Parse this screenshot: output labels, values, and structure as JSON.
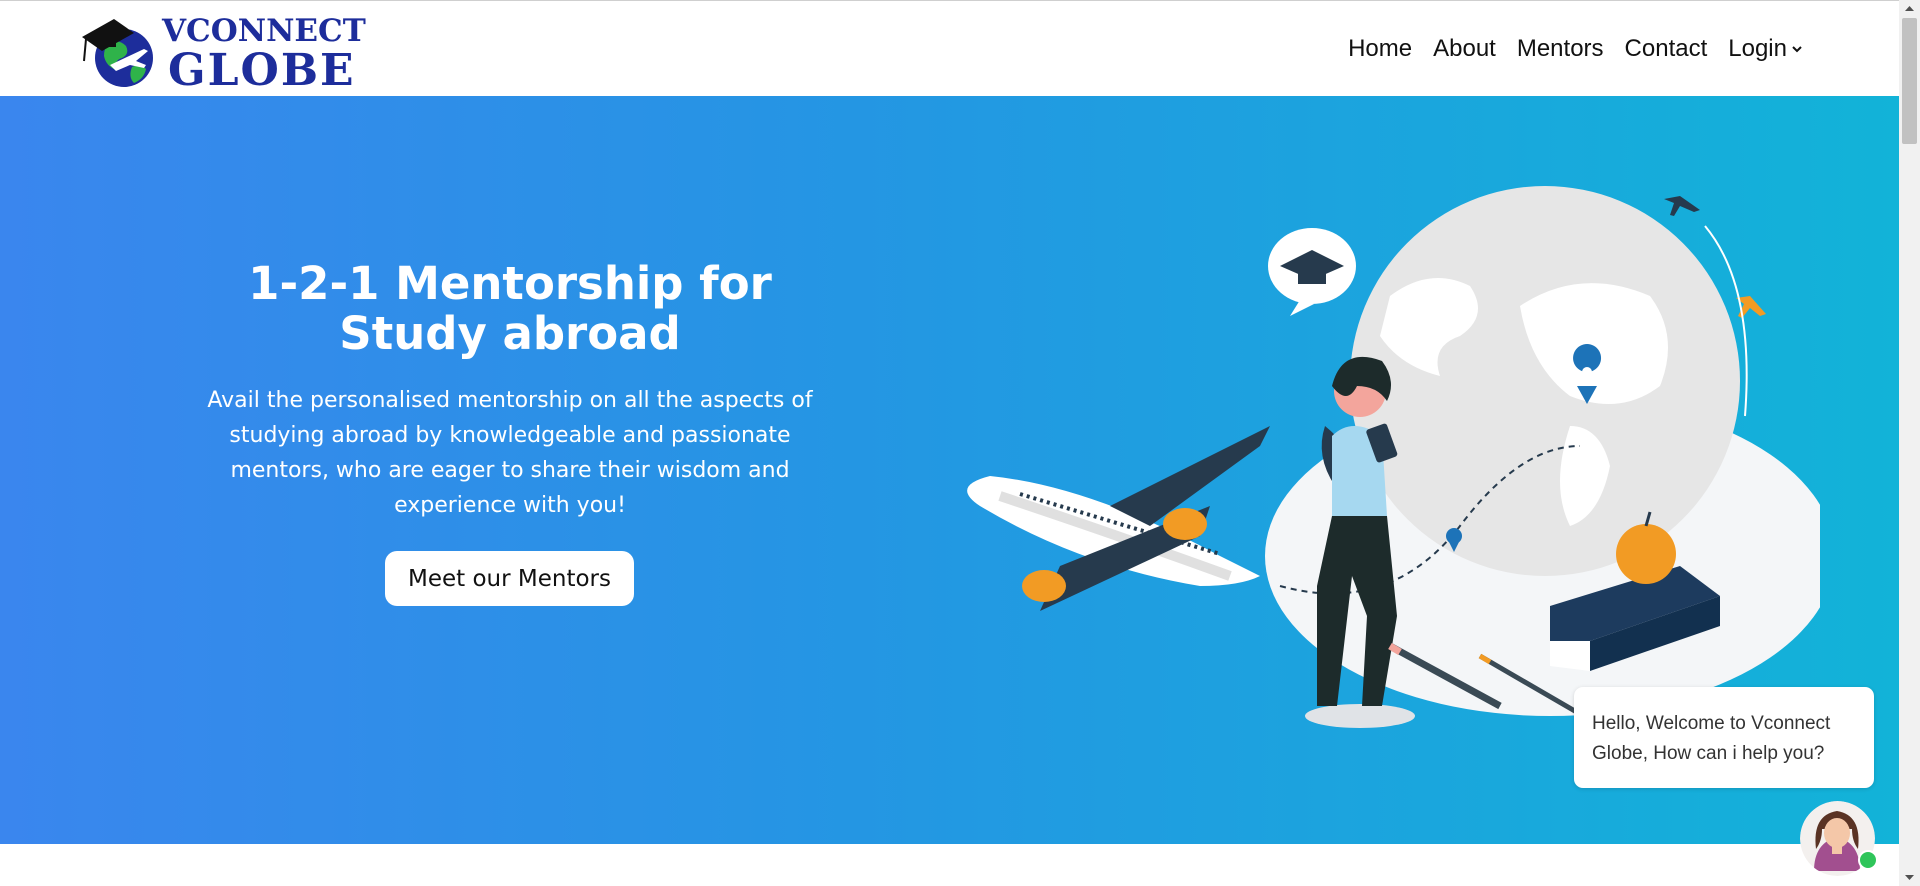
{
  "brand": {
    "logo_line1": "VCONNECT",
    "logo_line2": "GLOBE",
    "colors": {
      "logo_blue": "#1d2d9b",
      "logo_green": "#2fb34a"
    }
  },
  "nav": {
    "home": "Home",
    "about": "About",
    "mentors": "Mentors",
    "contact": "Contact",
    "login": "Login"
  },
  "hero": {
    "title": "1-2-1 Mentorship for\nStudy abroad",
    "description": "Avail the personalised mentorship on all the aspects of studying abroad by knowledgeable and passionate mentors, who are eager to share their wisdom and experience with you!",
    "cta_label": "Meet our Mentors",
    "colors": {
      "gradient_start": "#3a86ee",
      "gradient_end": "#12b3d8"
    }
  },
  "chat": {
    "message": "Hello, Welcome to Vconnect Globe, How can i help you?",
    "status_color": "#2fc55a"
  },
  "icons": [
    "graduation-cap-icon",
    "globe-icon",
    "airplane-icon",
    "chevron-down-icon",
    "map-pin-icon",
    "chat-avatar-icon"
  ]
}
